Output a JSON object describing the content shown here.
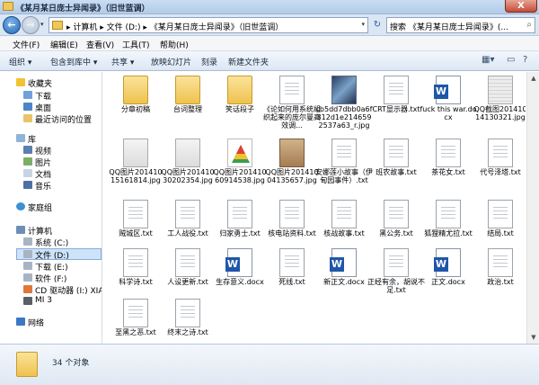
{
  "window": {
    "title": "《某月某日庞士异闻录》（旧世蓝调）",
    "close_glyph": "X"
  },
  "address": {
    "path": "▸ 计算机 ▸ 文件 (D:) ▸ 《某月某日庞士异闻录》（旧世蓝调）",
    "search_placeholder": "搜索 《某月某日庞士异闻录》(...",
    "back_glyph": "←",
    "forward_glyph": "→",
    "refresh_glyph": "↻",
    "search_icon": "magnifier-icon"
  },
  "menu": [
    "文件(F)",
    "编辑(E)",
    "查看(V)",
    "工具(T)",
    "帮助(H)"
  ],
  "toolbar": {
    "items": [
      "组织 ▾",
      "包含到库中 ▾",
      "共享 ▾",
      "放映幻灯片",
      "刻录",
      "新建文件夹"
    ]
  },
  "navigation": {
    "favorites": "收藏夹",
    "favorites_items": [
      "下载",
      "桌面",
      "最近访问的位置"
    ],
    "library": "库",
    "library_items": [
      "视频",
      "图片",
      "文档",
      "音乐"
    ],
    "homegroup": "家庭组",
    "computer": "计算机",
    "computer_items": [
      "系统 (C:)",
      "文件 (D:)",
      "下载 (E:)",
      "软件 (F:)",
      "CD 驱动器 (I:) XIA",
      "MI 3"
    ],
    "network": "网络"
  },
  "files": [
    {
      "name": "分章初稿",
      "icon": "folder-icon"
    },
    {
      "name": "台词整理",
      "icon": "folder-icon"
    },
    {
      "name": "笑话段子",
      "icon": "folder-icon"
    },
    {
      "name": "《论如何用系统组织起来的庞尔曼高效调...",
      "icon": "text-icon"
    },
    {
      "name": "cb5dd7dbb0a6f312d1e2146592537a63_r.jpg",
      "icon": "image-icon"
    },
    {
      "name": "CRT显示器.txt",
      "icon": "text-icon"
    },
    {
      "name": "fuck this war.docx",
      "icon": "word-icon"
    },
    {
      "name": "QQ截图20141014130321.jpg",
      "icon": "image-icon"
    },
    {
      "name": "QQ图片20141015161814.jpg",
      "icon": "image-icon"
    },
    {
      "name": "QQ图片20141030202354.jpg",
      "icon": "image-icon"
    },
    {
      "name": "QQ图片20141060914538.jpg",
      "icon": "image-icon"
    },
    {
      "name": "QQ图片20141004135657.jpg",
      "icon": "image-icon"
    },
    {
      "name": "安娜莲小故事（伊甸园事件）.txt",
      "icon": "text-icon"
    },
    {
      "name": "班农故事.txt",
      "icon": "text-icon"
    },
    {
      "name": "茶花女.txt",
      "icon": "text-icon"
    },
    {
      "name": "代号泽塔.txt",
      "icon": "text-icon"
    },
    {
      "name": "贼城区.txt",
      "icon": "text-icon"
    },
    {
      "name": "工人战役.txt",
      "icon": "text-icon"
    },
    {
      "name": "归家勇士.txt",
      "icon": "text-icon"
    },
    {
      "name": "核电站资料.txt",
      "icon": "text-icon"
    },
    {
      "name": "核战故事.txt",
      "icon": "text-icon"
    },
    {
      "name": "黑公务.txt",
      "icon": "text-icon"
    },
    {
      "name": "狐狸精尤拉.txt",
      "icon": "text-icon"
    },
    {
      "name": "结局.txt",
      "icon": "text-icon"
    },
    {
      "name": "科学诗.txt",
      "icon": "text-icon"
    },
    {
      "name": "人设更新.txt",
      "icon": "text-icon"
    },
    {
      "name": "生存意义.docx",
      "icon": "word-icon"
    },
    {
      "name": "死线.txt",
      "icon": "text-icon"
    },
    {
      "name": "新正文.docx",
      "icon": "word-icon"
    },
    {
      "name": "正经有余，胡说不足.txt",
      "icon": "text-icon"
    },
    {
      "name": "正文.docx",
      "icon": "word-icon"
    },
    {
      "name": "政治.txt",
      "icon": "text-icon"
    },
    {
      "name": "至黑之恶.txt",
      "icon": "text-icon"
    },
    {
      "name": "终末之诗.txt",
      "icon": "text-icon"
    }
  ],
  "status": {
    "count_text": "34 个对象"
  }
}
